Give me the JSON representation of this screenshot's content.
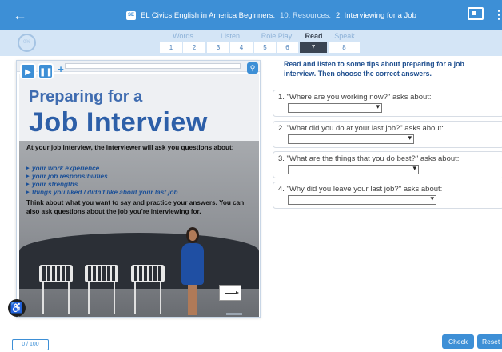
{
  "header": {
    "badge": "SE",
    "course": "EL Civics English in America Beginners:",
    "section": "10. Resources:",
    "lesson": "2. Interviewing for a Job",
    "icons": {
      "back": "back-arrow-icon",
      "screen": "screen-icon",
      "menu": "kebab-menu-icon"
    }
  },
  "progress": {
    "percent_label": "0%"
  },
  "skills": [
    {
      "label": "Words",
      "pages": [
        "1",
        "2"
      ]
    },
    {
      "label": "Listen",
      "pages": [
        "3",
        "4"
      ]
    },
    {
      "label": "Role Play",
      "pages": [
        "5",
        "6"
      ]
    },
    {
      "label": "Read",
      "pages": [
        "7"
      ],
      "active": true
    },
    {
      "label": "Speak",
      "pages": [
        "8"
      ]
    }
  ],
  "active_page": "7",
  "poster": {
    "title_small": "Preparing for a",
    "title_big": "Job Interview",
    "intro": "At your job interview, the interviewer will ask you questions about:",
    "topics": [
      "your work experience",
      "your job responsibilities",
      "your strengths",
      "things you liked / didn't like about your last job"
    ],
    "think": "Think about what you want to say and practice your answers. You can also ask questions about the job you're interviewing for."
  },
  "instructions": "Read and listen to some tips about preparing for a job interview. Then choose the correct answers.",
  "questions": [
    {
      "text": "1. \"Where are you working now?\" asks about:",
      "value": ""
    },
    {
      "text": "2. \"What did you do at your last job?\" asks about:",
      "value": ""
    },
    {
      "text": "3. \"What are the things that you do best?\" asks about:",
      "value": ""
    },
    {
      "text": "4. \"Why did you leave your last job?\" asks about:",
      "value": ""
    }
  ],
  "footer": {
    "score": "0 / 100",
    "check_label": "Check",
    "reset_label": "Reset"
  },
  "colors": {
    "primary": "#3d8fd6",
    "nav_bg": "#d4e5f6",
    "active_page": "#3a4452",
    "poster_blue": "#2d5fa8"
  }
}
